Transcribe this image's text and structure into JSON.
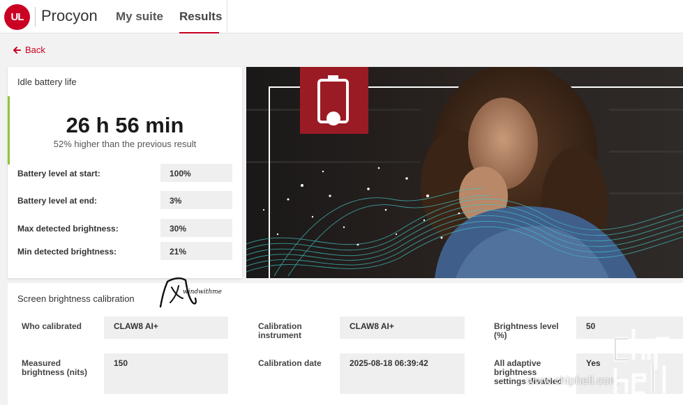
{
  "header": {
    "logo_text": "UL",
    "app_name": "Procyon",
    "tabs": [
      {
        "label": "My suite",
        "active": false
      },
      {
        "label": "Results",
        "active": true
      }
    ]
  },
  "back": {
    "label": "Back"
  },
  "result": {
    "title": "Idle battery life",
    "value": "26 h 56 min",
    "comparison": "52% higher than the previous result",
    "stats": [
      {
        "label": "Battery level at start:",
        "value": "100%"
      },
      {
        "label": "Battery level at end:",
        "value": "3%"
      },
      {
        "label": "Max detected brightness:",
        "value": "30%"
      },
      {
        "label": "Min detected brightness:",
        "value": "21%"
      }
    ]
  },
  "hero": {
    "icon": "battery-icon",
    "description_icon": "battery-icon"
  },
  "calibration": {
    "title": "Screen brightness calibration",
    "fields": [
      {
        "label": "Who calibrated",
        "value": "CLAW8 AI+"
      },
      {
        "label": "Calibration instrument",
        "value": "CLAW8 AI+"
      },
      {
        "label": "Brightness level (%)",
        "value": "50"
      },
      {
        "label": "Measured brightness (nits)",
        "value": "150"
      },
      {
        "label": "Calibration date",
        "value": "2025-08-18 06:39:42"
      },
      {
        "label": "All adaptive brightness settings disabled",
        "value": "Yes"
      }
    ]
  },
  "watermarks": {
    "signature": "windwithme",
    "site": "www.chiphell.com"
  },
  "colors": {
    "brand": "#ca0123",
    "accent_green": "#8cc63f",
    "background": "#f2f2f2"
  }
}
